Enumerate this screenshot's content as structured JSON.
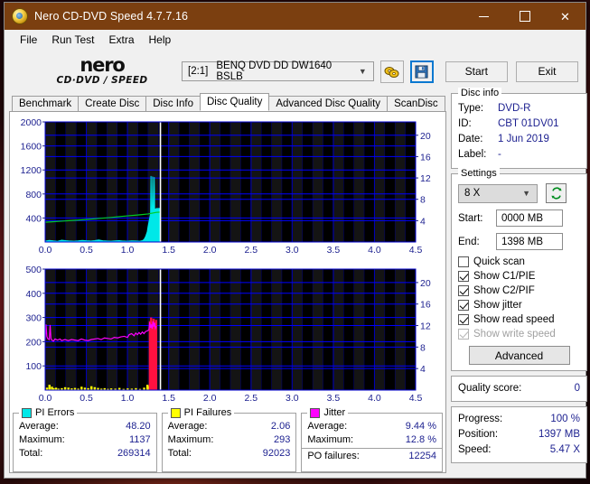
{
  "window": {
    "title": "Nero CD-DVD Speed 4.7.7.16",
    "app_icon": "nero-disc-icon",
    "minimize": "—",
    "maximize": "□",
    "close": "✕"
  },
  "menu": {
    "items": [
      "File",
      "Run Test",
      "Extra",
      "Help"
    ]
  },
  "toolbar": {
    "logo_word": "nero",
    "logo_sub": "CD·DVD ∕ SPEED",
    "drive_bay": "[2:1]",
    "drive_name": "BENQ DVD DD DW1640 BSLB",
    "dropdown_caret": "⌄",
    "icon1": "disc-speed-icon",
    "icon2": "save-floppy-icon",
    "start_label": "Start",
    "exit_label": "Exit"
  },
  "tabs": [
    {
      "label": "Benchmark",
      "active": false
    },
    {
      "label": "Create Disc",
      "active": false
    },
    {
      "label": "Disc Info",
      "active": false
    },
    {
      "label": "Disc Quality",
      "active": true
    },
    {
      "label": "Advanced Disc Quality",
      "active": false
    },
    {
      "label": "ScanDisc",
      "active": false
    }
  ],
  "disc_info": {
    "title": "Disc info",
    "type_label": "Type:",
    "type_value": "DVD-R",
    "id_label": "ID:",
    "id_value": "CBT 01DV01",
    "date_label": "Date:",
    "date_value": "1 Jun 2019",
    "label_label": "Label:",
    "label_value": "-"
  },
  "settings": {
    "title": "Settings",
    "speed_value": "8 X",
    "refresh_icon": "refresh-icon",
    "start_label": "Start:",
    "start_value": "0000 MB",
    "end_label": "End:",
    "end_value": "1398 MB",
    "checkboxes": [
      {
        "label": "Quick scan",
        "checked": false,
        "disabled": false
      },
      {
        "label": "Show C1/PIE",
        "checked": true,
        "disabled": false
      },
      {
        "label": "Show C2/PIF",
        "checked": true,
        "disabled": false
      },
      {
        "label": "Show jitter",
        "checked": true,
        "disabled": false
      },
      {
        "label": "Show read speed",
        "checked": true,
        "disabled": false
      },
      {
        "label": "Show write speed",
        "checked": true,
        "disabled": true
      }
    ],
    "advanced_label": "Advanced"
  },
  "quality": {
    "label": "Quality score:",
    "value": "0"
  },
  "status": {
    "progress_label": "Progress:",
    "progress_value": "100 %",
    "position_label": "Position:",
    "position_value": "1397 MB",
    "speed_label": "Speed:",
    "speed_value": "5.47 X"
  },
  "legend": {
    "pi_errors": {
      "title": "PI Errors",
      "color": "#00e8e8",
      "average_label": "Average:",
      "average_value": "48.20",
      "maximum_label": "Maximum:",
      "maximum_value": "1137",
      "total_label": "Total:",
      "total_value": "269314"
    },
    "pi_failures": {
      "title": "PI Failures",
      "color": "#ffff00",
      "average_label": "Average:",
      "average_value": "2.06",
      "maximum_label": "Maximum:",
      "maximum_value": "293",
      "total_label": "Total:",
      "total_value": "92023"
    },
    "jitter": {
      "title": "Jitter",
      "color": "#ff00ff",
      "average_label": "Average:",
      "average_value": "9.44 %",
      "maximum_label": "Maximum:",
      "maximum_value": "12.8 %",
      "po_label": "PO failures:",
      "po_value": "12254"
    }
  },
  "chart_data": [
    {
      "type": "area",
      "name": "pi-errors-graph",
      "title": "PI Errors / Read speed",
      "xlabel": "",
      "ylabel": "PI Errors",
      "xlim": [
        0.0,
        4.5
      ],
      "ylim": [
        0,
        2000
      ],
      "xticks": [
        0.0,
        0.5,
        1.0,
        1.5,
        2.0,
        2.5,
        3.0,
        3.5,
        4.0,
        4.5
      ],
      "xticklabels": [
        "0.0",
        "0.5",
        "1.0",
        "1.5",
        "2.0",
        "2.5",
        "3.0",
        "3.5",
        "4.0",
        "4.5"
      ],
      "yticks": [
        400,
        800,
        1200,
        1600,
        2000
      ],
      "yticklabels": [
        "400",
        "800",
        "1200",
        "1600",
        "2000"
      ],
      "y2lim": [
        0,
        22.5
      ],
      "y2ticks": [
        4,
        8,
        12,
        16,
        20
      ],
      "y2ticklabels": [
        "4",
        "8",
        "12",
        "16",
        "20"
      ],
      "grid": true,
      "background": "#000000",
      "gridcolor": "#0000ff",
      "scan_end_marker": 1.4,
      "series": [
        {
          "name": "PI Errors",
          "color": "#00e8e8",
          "style": "filled-area",
          "x": [
            0.0,
            0.05,
            0.1,
            0.15,
            0.2,
            0.25,
            0.3,
            0.35,
            0.4,
            0.45,
            0.5,
            0.55,
            0.6,
            0.65,
            0.7,
            0.75,
            0.8,
            0.85,
            0.9,
            0.95,
            1.0,
            1.05,
            1.1,
            1.15,
            1.18,
            1.2,
            1.22,
            1.24,
            1.25,
            1.26,
            1.27,
            1.28,
            1.285,
            1.29,
            1.3,
            1.305,
            1.31,
            1.32,
            1.325,
            1.33,
            1.34,
            1.35,
            1.36,
            1.37,
            1.38,
            1.39,
            1.4
          ],
          "values": [
            14,
            26,
            18,
            12,
            30,
            22,
            16,
            14,
            18,
            26,
            20,
            16,
            22,
            34,
            20,
            16,
            14,
            18,
            22,
            16,
            14,
            18,
            16,
            14,
            22,
            40,
            90,
            170,
            260,
            330,
            400,
            470,
            1100,
            500,
            520,
            1090,
            540,
            530,
            1080,
            545,
            550,
            555,
            560,
            555,
            560,
            558,
            560
          ]
        },
        {
          "name": "Read speed",
          "color": "#00cc22",
          "style": "line",
          "axis": "right",
          "x": [
            0.0,
            0.2,
            0.4,
            0.6,
            0.8,
            1.0,
            1.15,
            1.25,
            1.3,
            1.35,
            1.4
          ],
          "values": [
            3.7,
            3.9,
            4.1,
            4.35,
            4.6,
            4.9,
            5.1,
            5.25,
            5.4,
            5.55,
            5.6
          ]
        }
      ]
    },
    {
      "type": "line",
      "name": "pi-failures-jitter-graph",
      "title": "PI Failures / Jitter",
      "xlabel": "",
      "ylabel": "PI Failures",
      "xlim": [
        0.0,
        4.5
      ],
      "ylim": [
        0,
        500
      ],
      "xticks": [
        0.0,
        0.5,
        1.0,
        1.5,
        2.0,
        2.5,
        3.0,
        3.5,
        4.0,
        4.5
      ],
      "xticklabels": [
        "0.0",
        "0.5",
        "1.0",
        "1.5",
        "2.0",
        "2.5",
        "3.0",
        "3.5",
        "4.0",
        "4.5"
      ],
      "yticks": [
        100,
        200,
        300,
        400,
        500
      ],
      "yticklabels": [
        "100",
        "200",
        "300",
        "400",
        "500"
      ],
      "y2lim": [
        0,
        22.5
      ],
      "y2ticks": [
        4,
        8,
        12,
        16,
        20
      ],
      "y2ticklabels": [
        "4",
        "8",
        "12",
        "16",
        "20"
      ],
      "grid": true,
      "background": "#000000",
      "gridcolor": "#0000ff",
      "scan_end_marker": 1.4,
      "series": [
        {
          "name": "PI Failures",
          "color": "#ffff00",
          "style": "bars",
          "x": [
            0.02,
            0.05,
            0.08,
            0.1,
            0.13,
            0.16,
            0.2,
            0.24,
            0.28,
            0.32,
            0.36,
            0.4,
            0.44,
            0.48,
            0.52,
            0.56,
            0.6,
            0.64,
            0.68,
            0.72,
            0.76,
            0.8,
            0.85,
            0.9,
            0.95,
            1.0,
            1.05,
            1.1,
            1.15,
            1.2,
            1.24,
            1.26,
            1.28
          ],
          "values": [
            10,
            22,
            14,
            8,
            10,
            6,
            8,
            12,
            10,
            7,
            9,
            6,
            14,
            10,
            8,
            16,
            12,
            9,
            6,
            8,
            5,
            7,
            6,
            9,
            5,
            7,
            6,
            8,
            5,
            10,
            22,
            16,
            12
          ]
        },
        {
          "name": "PO failures",
          "color": "#ff1040",
          "style": "bars",
          "x": [
            1.27,
            1.285,
            1.3,
            1.315,
            1.33,
            1.345
          ],
          "values": [
            285,
            300,
            275,
            295,
            280,
            290
          ]
        },
        {
          "name": "Jitter",
          "color": "#ff00ff",
          "style": "line",
          "axis": "right",
          "x": [
            0.0,
            0.01,
            0.02,
            0.03,
            0.05,
            0.06,
            0.07,
            0.08,
            0.1,
            0.12,
            0.15,
            0.18,
            0.2,
            0.24,
            0.28,
            0.32,
            0.36,
            0.4,
            0.44,
            0.48,
            0.52,
            0.56,
            0.6,
            0.64,
            0.68,
            0.72,
            0.76,
            0.8,
            0.84,
            0.88,
            0.92,
            0.96,
            1.0,
            1.02,
            1.05,
            1.08,
            1.1,
            1.12,
            1.14,
            1.16,
            1.18,
            1.2,
            1.22,
            1.24,
            1.26,
            1.27,
            1.28,
            1.29,
            1.3,
            1.31,
            1.32,
            1.33,
            1.34,
            1.35
          ],
          "values": [
            9.2,
            12.2,
            10.0,
            9.6,
            9.4,
            12.1,
            9.6,
            9.3,
            9.1,
            9.5,
            9.3,
            9.5,
            9.2,
            9.4,
            9.2,
            9.4,
            9.3,
            9.2,
            9.5,
            9.3,
            9.2,
            9.4,
            9.5,
            9.6,
            9.4,
            9.7,
            9.6,
            9.5,
            9.8,
            9.7,
            9.9,
            10.0,
            9.8,
            10.3,
            10.5,
            10.1,
            10.6,
            10.3,
            10.7,
            10.4,
            10.8,
            10.5,
            10.9,
            11.0,
            11.2,
            12.6,
            11.6,
            12.2,
            11.4,
            12.8,
            11.8,
            12.5,
            11.5,
            11.9
          ]
        }
      ]
    }
  ]
}
